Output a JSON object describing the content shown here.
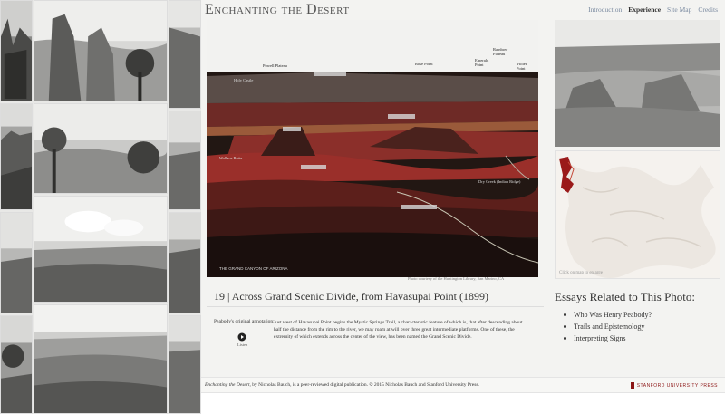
{
  "header": {
    "site_title": "Enchanting the Desert",
    "nav": [
      {
        "label": "Introduction",
        "active": false
      },
      {
        "label": "Experience",
        "active": true
      },
      {
        "label": "Site Map",
        "active": false
      },
      {
        "label": "Credits",
        "active": false
      }
    ]
  },
  "main_photo": {
    "labels": {
      "powell_plateau": "Powell Plateau",
      "north_bass_trail": "North Bass Trail",
      "rose_point": "Rose Point",
      "rainbow_plateau": "Rainbow Plateau",
      "emerald_point": "Emerald Point",
      "violet_point": "Violet Point",
      "holy_castle": "Holy Castle",
      "wallace_butte": "Wallace Butte",
      "dry_creek": "Dry Creek (Indian Ridge)"
    },
    "credit": "Photo courtesy of the Huntington Library, San Marino, CA"
  },
  "caption": {
    "title": "19 | Across Grand Scenic Divide, from Havasupai Point (1899)",
    "annotation_label": "Peabody's original annotation:",
    "audio_label": "Listen",
    "annotation_text": "Just west of Havasupai Point begins the Mystic Springs Trail, a characteristic feature of which is, that after descending about half the distance from the rim to the river, we may roam at will over three great intermediate platforms. One of these, the extremity of which extends across the center of the view, has been named the Grand Scenic Divide."
  },
  "map": {
    "hint": "Click on map to enlarge"
  },
  "essays": {
    "title": "Essays Related to This Photo:",
    "items": [
      "Who Was Henry Peabody?",
      "Trails and Epistemology",
      "Interpreting Signs"
    ]
  },
  "footer": {
    "book_title": "Enchanting the Desert",
    "text": ", by Nicholas Bauch, is a peer-reviewed digital publication. © 2015 Nicholas Bauch and Stanford University Press.",
    "press": "STANFORD UNIVERSITY PRESS"
  },
  "colors": {
    "press_red": "#8c1515",
    "nav_link": "#7a8aa0",
    "canyon_red": "#9a2f2a"
  }
}
